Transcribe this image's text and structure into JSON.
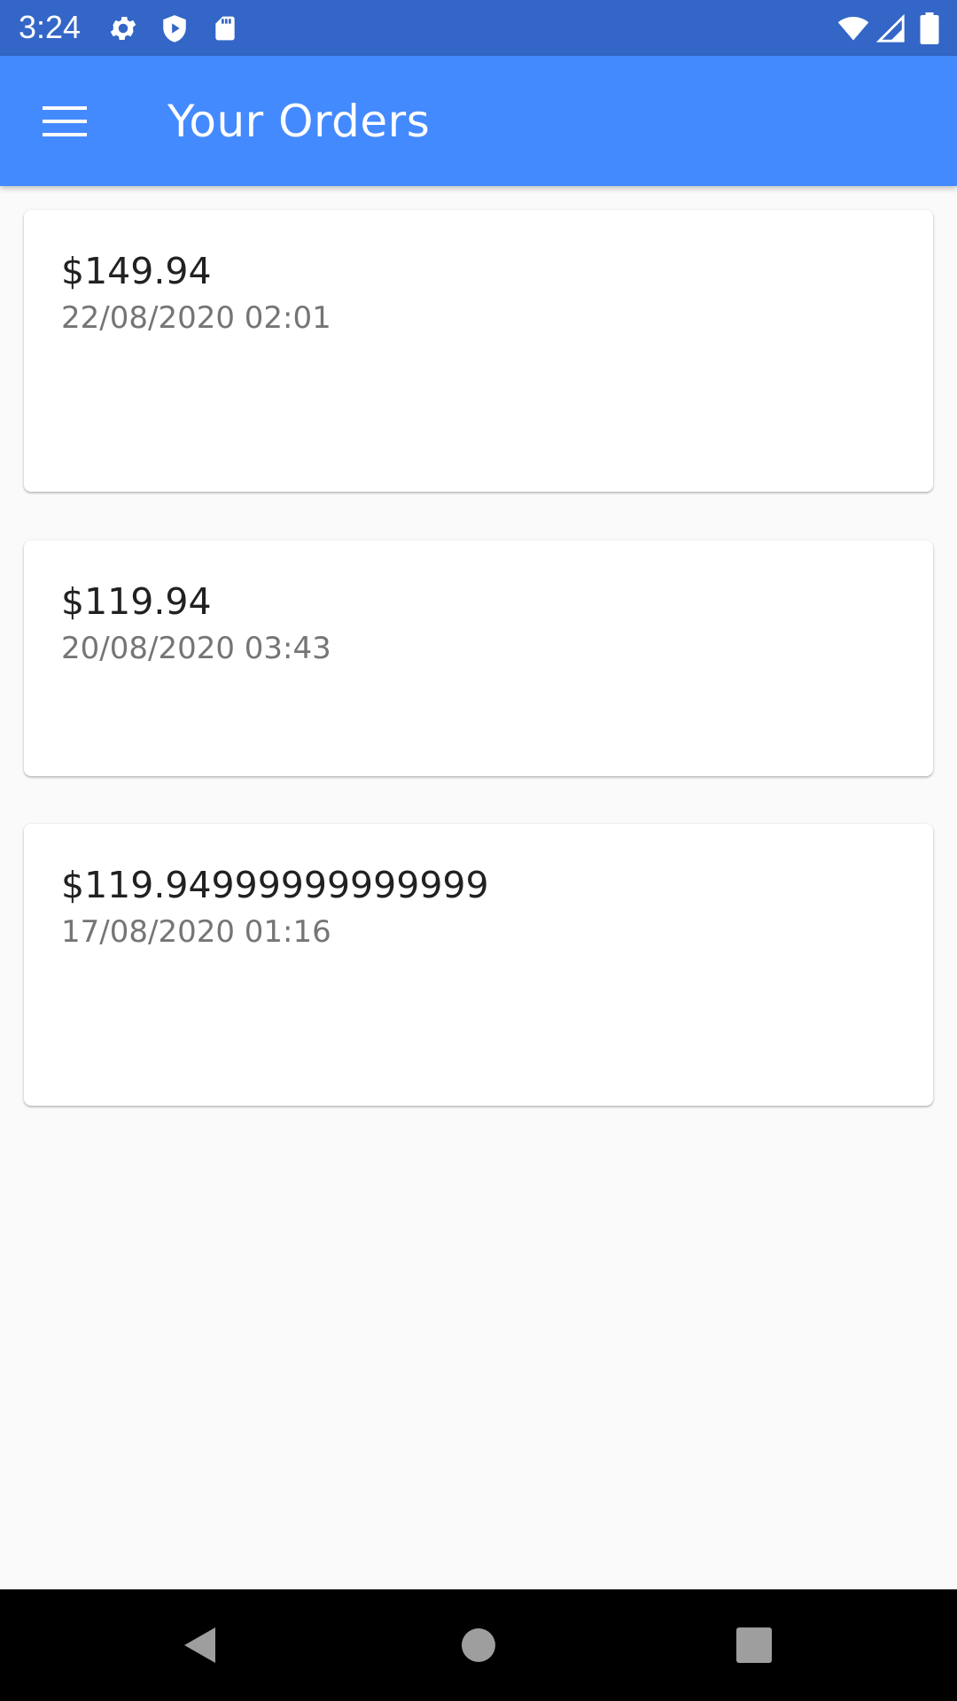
{
  "status_bar": {
    "time": "3:24",
    "icons_left": [
      "gear-icon",
      "shield-play-icon",
      "sd-card-icon"
    ],
    "icons_right": [
      "wifi-icon",
      "signal-icon",
      "battery-icon"
    ],
    "background": "#3366c6"
  },
  "app_bar": {
    "title": "Your Orders",
    "menu_icon": "hamburger-menu-icon",
    "background": "#448aff"
  },
  "orders": [
    {
      "total": "$149.94",
      "date": "22/08/2020 02:01"
    },
    {
      "total": "$119.94",
      "date": "20/08/2020 03:43"
    },
    {
      "total": "$119.94999999999999",
      "date": "17/08/2020 01:16"
    }
  ],
  "nav_bar": {
    "buttons": [
      "back-icon",
      "home-icon",
      "recents-icon"
    ]
  }
}
